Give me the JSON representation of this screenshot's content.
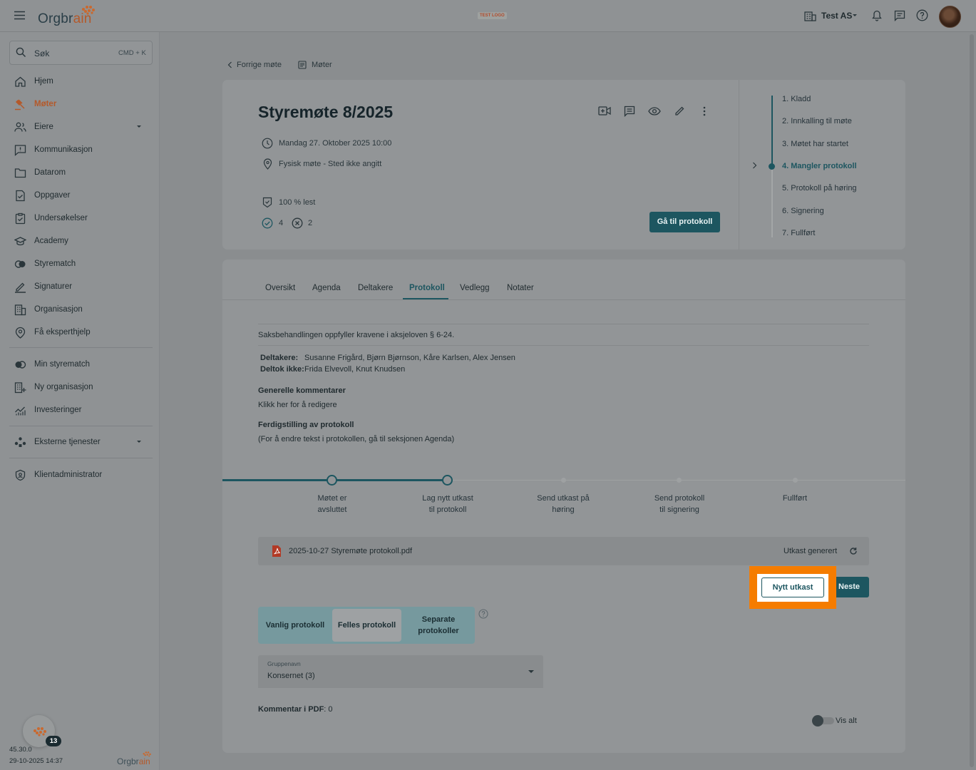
{
  "topbar": {
    "logo_main": "Orgbr",
    "logo_accent": "ain",
    "test_logo": "TEST LOGO",
    "org_name": "Test AS"
  },
  "sidebar": {
    "search_label": "Søk",
    "search_shortcut": "CMD + K",
    "items": [
      {
        "label": "Hjem",
        "icon": "home-icon"
      },
      {
        "label": "Møter",
        "icon": "gavel-icon",
        "active": true
      },
      {
        "label": "Eiere",
        "icon": "owners-icon",
        "expandable": true
      },
      {
        "label": "Kommunikasjon",
        "icon": "message-icon"
      },
      {
        "label": "Datarom",
        "icon": "folder-icon"
      },
      {
        "label": "Oppgaver",
        "icon": "tasks-icon"
      },
      {
        "label": "Undersøkelser",
        "icon": "survey-icon"
      },
      {
        "label": "Academy",
        "icon": "academy-icon"
      },
      {
        "label": "Styrematch",
        "icon": "match-icon"
      },
      {
        "label": "Signaturer",
        "icon": "signature-icon"
      },
      {
        "label": "Organisasjon",
        "icon": "building-icon"
      },
      {
        "label": "Få eksperthjelp",
        "icon": "expert-icon"
      }
    ],
    "items2": [
      {
        "label": "Min styrematch",
        "icon": "match-icon"
      },
      {
        "label": "Ny organisasjon",
        "icon": "building-add-icon"
      },
      {
        "label": "Investeringer",
        "icon": "chart-icon"
      }
    ],
    "external": {
      "label": "Eksterne tjenester",
      "icon": "apps-icon"
    },
    "admin": {
      "label": "Klientadministrator",
      "icon": "shield-icon"
    },
    "version": "45.30.0",
    "version_date": "29-10-2025 14:37",
    "badge_count": "13",
    "footer_logo_main": "Orgbr",
    "footer_logo_accent": "ain"
  },
  "breadcrumb": {
    "back": "Forrige møte",
    "meetings": "Møter"
  },
  "meeting": {
    "title": "Styremøte 8/2025",
    "datetime": "Mandag 27. Oktober 2025 10:00",
    "location": "Fysisk møte - Sted ikke angitt",
    "read_percent": "100 % lest",
    "accepted_count": "4",
    "declined_count": "2",
    "goto_protocol": "Gå til protokoll"
  },
  "status_steps": [
    {
      "label": "1. Kladd"
    },
    {
      "label": "2. Innkalling til møte"
    },
    {
      "label": "3. Møtet har startet"
    },
    {
      "label": "4. Mangler protokoll",
      "current": true
    },
    {
      "label": "5. Protokoll på høring"
    },
    {
      "label": "6. Signering"
    },
    {
      "label": "7. Fullført"
    }
  ],
  "tabs": [
    "Oversikt",
    "Agenda",
    "Deltakere",
    "Protokoll",
    "Vedlegg",
    "Notater"
  ],
  "active_tab": "Protokoll",
  "protocol": {
    "requirements_text": "Saksbehandlingen oppfyller kravene i aksjeloven § 6-24.",
    "participants_label": "Deltakere:",
    "participants": "Susanne Frigård, Bjørn Bjørnson, Kåre Karlsen, Alex Jensen",
    "absent_label": "Deltok ikke:",
    "absent": "Frida Elvevoll, Knut Knudsen",
    "general_comments_heading": "Generelle kommentarer",
    "general_comments_text": "Klikk her for å redigere",
    "finalization_heading": "Ferdigstilling av protokoll",
    "finalization_text": "(For å endre tekst i protokollen, gå til seksjonen Agenda)"
  },
  "progress_steps": [
    {
      "line1": "Møtet er",
      "line2": "avsluttet",
      "done": true
    },
    {
      "line1": "Lag nytt utkast",
      "line2": "til protokoll",
      "done": true
    },
    {
      "line1": "Send utkast på",
      "line2": "høring",
      "done": false
    },
    {
      "line1": "Send protokoll",
      "line2": "til signering",
      "done": false
    },
    {
      "line1": "Fullført",
      "line2": "",
      "done": false
    }
  ],
  "file": {
    "name": "2025-10-27 Styremøte protokoll.pdf",
    "status": "Utkast generert"
  },
  "actions": {
    "new_draft": "Nytt utkast",
    "next": "Neste"
  },
  "protocol_type": {
    "options": [
      {
        "line1": "Vanlig protokoll",
        "line2": ""
      },
      {
        "line1": "Felles protokoll",
        "line2": "",
        "selected": true
      },
      {
        "line1": "Separate",
        "line2": "protokoller"
      }
    ]
  },
  "group_select": {
    "label": "Gruppenavn",
    "value": "Konsernet (3)"
  },
  "pdf_comments": {
    "label": "Kommentar i PDF",
    "value": ": 0"
  },
  "show_all": "Vis alt",
  "colors": {
    "primary": "#1d5660",
    "accent": "#b4592a",
    "highlight": "#f57c00"
  }
}
